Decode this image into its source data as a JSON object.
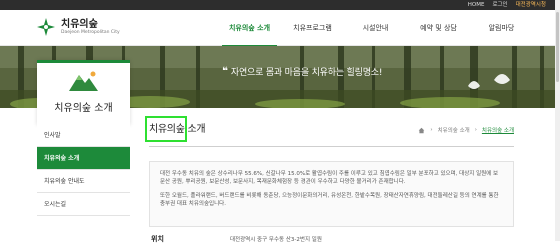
{
  "utility": {
    "home": "HOME",
    "login": "로그인",
    "gov": "대전광역시청"
  },
  "logo": {
    "title": "치유의숲",
    "subtitle": "Daejeon Metropolitan City"
  },
  "gnb": [
    {
      "label": "치유의숲 소개"
    },
    {
      "label": "치유프로그램"
    },
    {
      "label": "시설안내"
    },
    {
      "label": "예약 및 상담"
    },
    {
      "label": "알림마당"
    }
  ],
  "banner": {
    "quote": "❝",
    "message": "자연으로 몸과 마음을 치유하는 힐링명소!"
  },
  "sidebar": {
    "title": "치유의숲 소개",
    "items": [
      {
        "label": "인사말"
      },
      {
        "label": "치유의숲 소개"
      },
      {
        "label": "치유의숲 안내도"
      },
      {
        "label": "오시는길"
      }
    ]
  },
  "content": {
    "title": "치유의숲 소개",
    "breadcrumb": [
      "치유의숲 소개",
      "치유의숲 소개"
    ],
    "para1": "대전 우수동 치유의 숲은 상수리나무 55.6%, 신갈나무 15.0%로 활엽수림이 주를 이루고 있고 침엽수림은 일부 분포하고 있으며, 대상지 일원에 보문산 공원, 뿌리공원, 보문산성, 보문사지, 목재문화체험장 등 경관이 우수하고 다양한 볼거리가 존재합니다.",
    "para2": "또한 오월드, 플라워랜드, 버드랜드를 비롯해 동춘당, 으능정이문화의거리, 유성온천, 한밭수목원, 장태산자연휴양림, 대전둘레산길 등의 연계를 통한 충부권 대표 치유의숲입니다.",
    "location_label": "위치",
    "location_value": "대전광역시 중구 무수동 산3-2번지 일원"
  },
  "colors": {
    "brand": "#1d8a3a",
    "focus": "#2ee031"
  }
}
